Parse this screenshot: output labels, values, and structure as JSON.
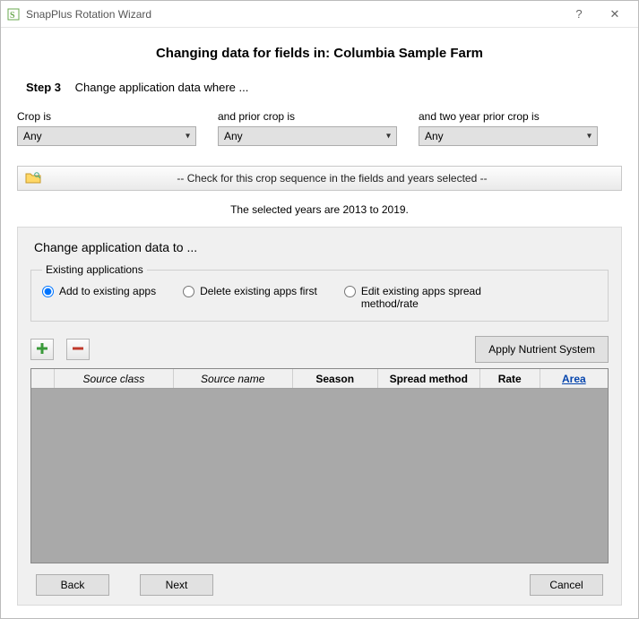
{
  "window": {
    "title": "SnapPlus Rotation Wizard"
  },
  "heading": "Changing data for fields in: Columbia Sample Farm",
  "step": {
    "label": "Step 3",
    "text": "Change application data where ..."
  },
  "crops": {
    "crop_label": "Crop is",
    "crop_value": "Any",
    "prior_label": "and prior crop is",
    "prior_value": "Any",
    "prior2_label": "and two year prior crop is",
    "prior2_value": "Any"
  },
  "check_bar": "-- Check for this crop sequence in the fields and years selected --",
  "selected_years": "The selected years are 2013 to 2019.",
  "panel_title": "Change application data to ...",
  "existing": {
    "legend": "Existing applications",
    "opt_add": "Add to existing apps",
    "opt_delete": "Delete existing apps first",
    "opt_edit": "Edit existing apps spread method/rate"
  },
  "apply_btn": "Apply Nutrient System",
  "grid": {
    "cols": {
      "source_class": "Source class",
      "source_name": "Source name",
      "season": "Season",
      "spread": "Spread method",
      "rate": "Rate",
      "area": "Area"
    }
  },
  "footer": {
    "back": "Back",
    "next": "Next",
    "cancel": "Cancel"
  }
}
